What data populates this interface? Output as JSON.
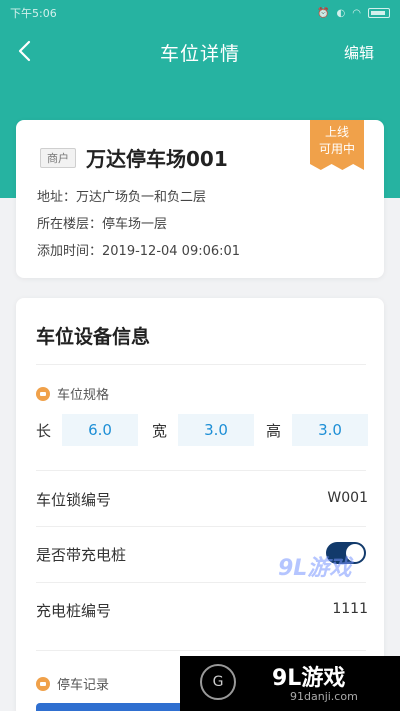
{
  "status_bar": {
    "time": "下午5:06"
  },
  "nav": {
    "title": "车位详情",
    "edit": "编辑"
  },
  "lot": {
    "tag": "商户",
    "name": "万达停车场001",
    "address": "地址：万达广场负一和负二层",
    "floor": "所在楼层：停车场一层",
    "added": "添加时间：2019-12-04 09:06:01",
    "badge_line1": "上线",
    "badge_line2": "可用中"
  },
  "device": {
    "title": "车位设备信息",
    "spec_head": "车位规格",
    "length_label": "长",
    "length_value": "6.0",
    "width_label": "宽",
    "width_value": "3.0",
    "height_label": "高",
    "height_value": "3.0",
    "lock_label": "车位锁编号",
    "lock_value": "W001",
    "charger_label": "是否带充电桩",
    "charger_on": true,
    "charger_no_label": "充电桩编号",
    "charger_no_value": "1111",
    "record_head": "停车记录"
  },
  "watermarks": {
    "wm1": "9L游戏",
    "wm2_logo": "G",
    "wm2_text": "9L游戏",
    "wm2_sub": "91danji.com"
  },
  "colors": {
    "header": "#26b3a1",
    "accent": "#f0a14a",
    "value_blue": "#1e8fd6",
    "toggle": "#123a6b"
  },
  "icons": {
    "back": "chevron-left-icon",
    "sub_head": "parking-icon"
  }
}
